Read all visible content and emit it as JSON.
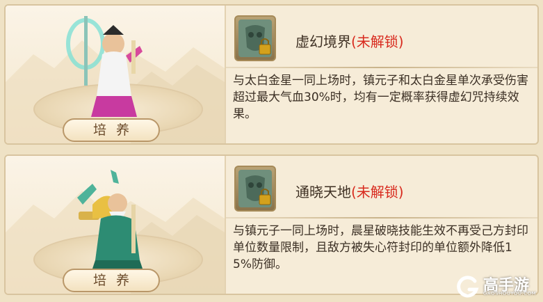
{
  "cards": [
    {
      "hero_icon": "spellcaster-hero-icon",
      "button_label": "培养",
      "skill": {
        "icon": "locked-mask-skill-icon",
        "name": "虚幻境界",
        "lock_status": "(未解锁)",
        "description": "与太白金星一同上场时，镇元子和太白金星单次承受伤害超过最大气血30%时，均有一定概率获得虚幻咒持续效果。"
      }
    },
    {
      "hero_icon": "elder-sage-hero-icon",
      "button_label": "培养",
      "skill": {
        "icon": "locked-mask-skill-icon",
        "name": "通晓天地",
        "lock_status": "(未解锁)",
        "description": "与镇元子一同上场时，晨星破晓技能生效不再受己方封印单位数量限制，且敌方被失心符封印的单位额外降低15%防御。"
      }
    }
  ],
  "watermark": {
    "brand": "高手游",
    "site": "GAOSHOUYOU.COM"
  },
  "colors": {
    "lock_status": "#d82a1e",
    "text": "#3b2f24",
    "card_bg": "#f6ecd8"
  }
}
